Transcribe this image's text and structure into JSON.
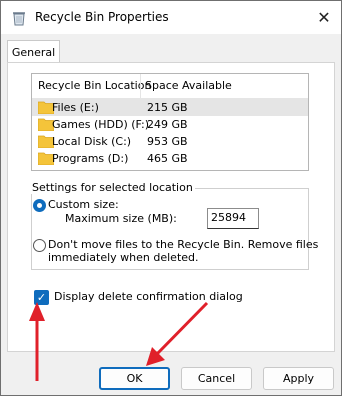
{
  "window": {
    "title": "Recycle Bin Properties",
    "close_glyph": "✕"
  },
  "tabs": [
    {
      "label": "General",
      "selected": true
    }
  ],
  "list": {
    "headers": {
      "location": "Recycle Bin Location",
      "space": "Space Available"
    },
    "rows": [
      {
        "location": "Files (E:)",
        "space": "215 GB",
        "selected": true
      },
      {
        "location": "Games (HDD) (F:)",
        "space": "249 GB",
        "selected": false
      },
      {
        "location": "Local Disk (C:)",
        "space": "953 GB",
        "selected": false
      },
      {
        "location": "Programs  (D:)",
        "space": "465 GB",
        "selected": false
      }
    ]
  },
  "settings": {
    "group_label": "Settings for selected location",
    "custom_size_label": "Custom size:",
    "max_size_label": "Maximum size (MB):",
    "max_size_value": "25894",
    "dont_move_line1": "Don't move files to the Recycle Bin. Remove files",
    "dont_move_line2": "immediately when deleted.",
    "selected_option": "custom"
  },
  "confirm_dialog": {
    "label": "Display delete confirmation dialog",
    "checked": true
  },
  "buttons": {
    "ok": "OK",
    "cancel": "Cancel",
    "apply": "Apply"
  },
  "colors": {
    "accent": "#0f6cbd",
    "annotation_arrow": "#e0202a",
    "folder": "#f4c43a"
  }
}
